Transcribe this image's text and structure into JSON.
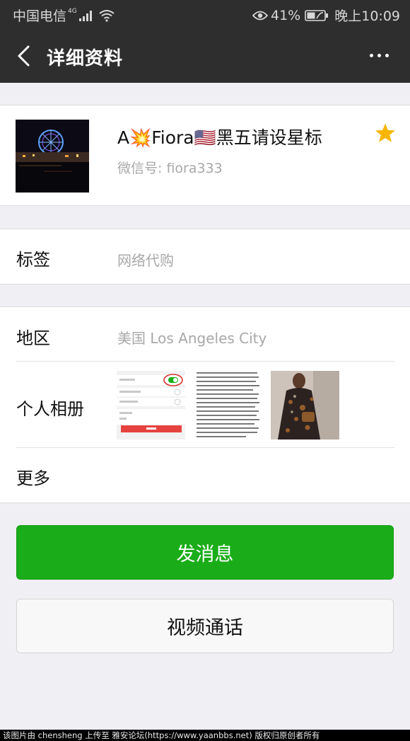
{
  "status_bar": {
    "carrier": "中国电信",
    "network": "4G",
    "battery": "41%",
    "time": "晚上10:09"
  },
  "nav": {
    "title": "详细资料",
    "back_icon": "back-chevron-icon",
    "more_icon": "more-dots-icon"
  },
  "profile": {
    "name": "A💥Fiora🇺🇸黑五请设星标",
    "wechat_id": "微信号: fiora333",
    "starred": true
  },
  "tags": {
    "label": "标签",
    "value": "网络代购"
  },
  "region": {
    "label": "地区",
    "value": "美国  Los Angeles City"
  },
  "album": {
    "label": "个人相册"
  },
  "more": {
    "label": "更多"
  },
  "actions": {
    "send_message": "发消息",
    "video_call": "视频通话"
  },
  "footer": "该图片由 chensheng 上传至 雅安论坛(https://www.yaanbbs.net) 版权归原创者所有",
  "colors": {
    "header_bg": "#2e2e2e",
    "primary_green": "#1aad19",
    "star": "#f7b500",
    "secondary_text": "#a8a8a8"
  }
}
